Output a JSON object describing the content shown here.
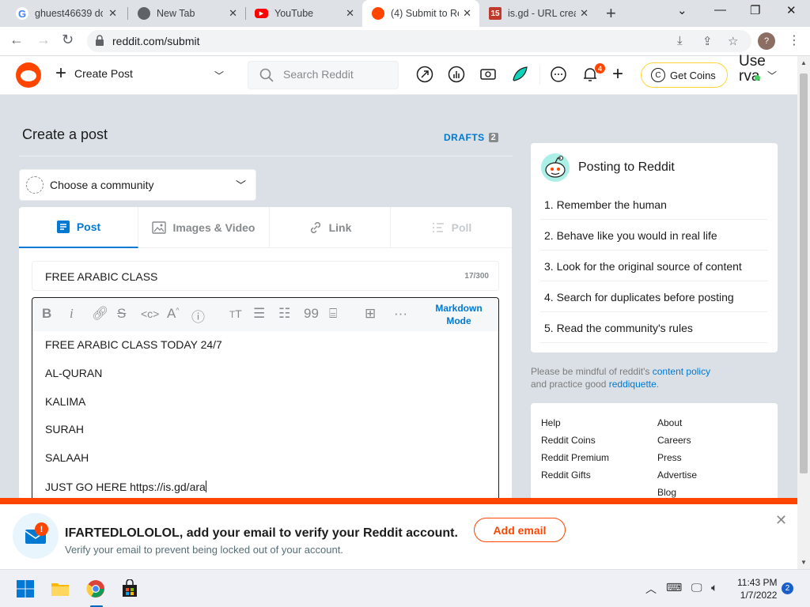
{
  "browser": {
    "tabs": [
      {
        "title": "ghuest46639 do",
        "favicon": "google-icon",
        "active": false
      },
      {
        "title": "New Tab",
        "favicon": "chrome-icon",
        "active": false
      },
      {
        "title": "YouTube",
        "favicon": "youtube-icon",
        "active": false
      },
      {
        "title": "(4) Submit to Re",
        "favicon": "reddit-icon",
        "active": true
      },
      {
        "title": "is.gd - URL crea",
        "favicon": "isgd-icon",
        "active": false
      }
    ],
    "url": "reddit.com/submit",
    "profile_initial": "?"
  },
  "header": {
    "create_post_label": "Create Post",
    "search_placeholder": "Search Reddit",
    "notification_count": "4",
    "get_coins_label": "Get Coins",
    "user_line1": "Use",
    "user_line2": "rva"
  },
  "main": {
    "page_title": "Create a post",
    "drafts_label": "DRAFTS",
    "drafts_count": "2",
    "community_placeholder": "Choose a community",
    "tabs": [
      {
        "label": "Post",
        "active": true
      },
      {
        "label": "Images & Video",
        "active": false
      },
      {
        "label": "Link",
        "active": false
      },
      {
        "label": "Poll",
        "active": false,
        "disabled": true
      }
    ],
    "post_title": "FREE ARABIC CLASS",
    "char_count": "17/300",
    "markdown_mode_line1": "Markdown",
    "markdown_mode_line2": "Mode",
    "body_lines": [
      "FREE ARABIC CLASS TODAY 24/7",
      "AL-QURAN",
      "KALIMA",
      "SURAH",
      "SALAAH",
      "JUST GO HERE https://is.gd/ara"
    ]
  },
  "sidebar": {
    "rules_title": "Posting to Reddit",
    "rules": [
      "1. Remember the human",
      "2. Behave like you would in real life",
      "3. Look for the original source of content",
      "4. Search for duplicates before posting",
      "5. Read the community's rules"
    ],
    "mindful_prefix": "Please be mindful of reddit's ",
    "content_policy": "content policy",
    "mindful_mid": "and practice good ",
    "reddiquette": "reddiquette",
    "mindful_end": ".",
    "links_col1": [
      "Help",
      "Reddit Coins",
      "Reddit Premium",
      "Reddit Gifts"
    ],
    "links_col2": [
      "About",
      "Careers",
      "Press",
      "Advertise",
      "Blog"
    ]
  },
  "banner": {
    "message": "IFARTEDLOLOLOL, add your email to verify your Reddit account.",
    "sub": "Verify your email to prevent being locked out of your account.",
    "button": "Add email",
    "badge": "!"
  },
  "taskbar": {
    "time": "11:43 PM",
    "date": "1/7/2022",
    "notifications": "2"
  },
  "colors": {
    "reddit_orange": "#ff4500",
    "link_blue": "#0079d3",
    "page_bg": "#dae0e6"
  }
}
